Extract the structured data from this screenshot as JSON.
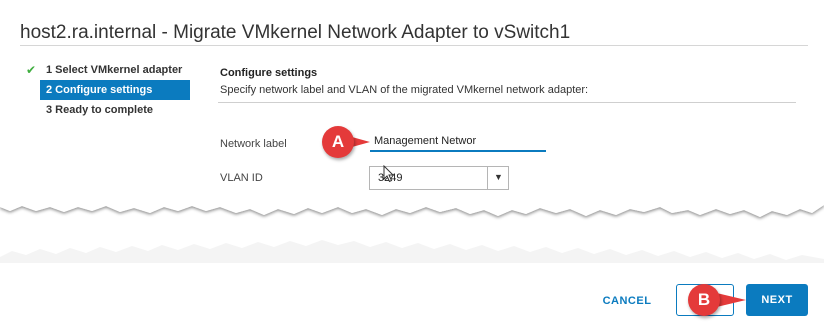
{
  "dialog": {
    "title": "host2.ra.internal - Migrate VMkernel Network Adapter to vSwitch1"
  },
  "steps": [
    {
      "label": "1 Select VMkernel adapter",
      "status": "done"
    },
    {
      "label": "2 Configure settings",
      "status": "active"
    },
    {
      "label": "3 Ready to complete",
      "status": "todo"
    }
  ],
  "content": {
    "heading": "Configure settings",
    "description": "Specify network label and VLAN of the migrated VMkernel network adapter:"
  },
  "fields": {
    "network_label": {
      "label": "Network label",
      "value": "Management Networ"
    },
    "vlan_id": {
      "label": "VLAN ID",
      "value": "3249"
    }
  },
  "footer": {
    "cancel_label": "CANCEL",
    "next_label": "NEXT"
  },
  "annotations": {
    "a": "A",
    "b": "B"
  },
  "colors": {
    "accent": "#0b7bbf",
    "annotation": "#e43a3a",
    "check": "#3fae3f"
  }
}
